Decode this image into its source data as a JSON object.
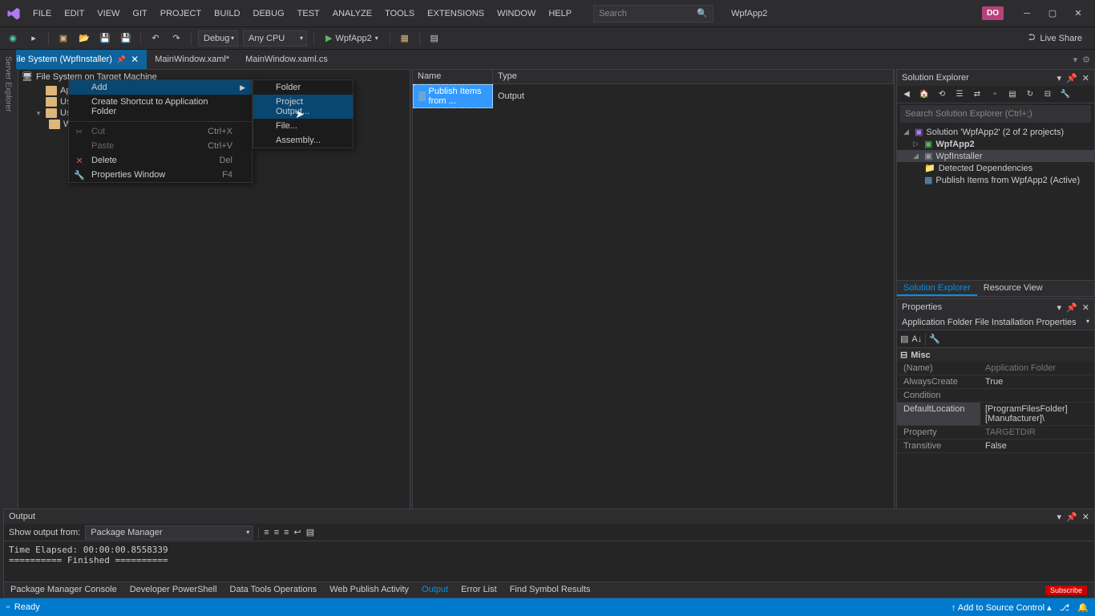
{
  "titlebar": {
    "menu": [
      "FILE",
      "EDIT",
      "VIEW",
      "GIT",
      "PROJECT",
      "BUILD",
      "DEBUG",
      "TEST",
      "ANALYZE",
      "TOOLS",
      "EXTENSIONS",
      "WINDOW",
      "HELP"
    ],
    "search_placeholder": "Search",
    "app_title": "WpfApp2",
    "user_initials": "DO"
  },
  "toolbar": {
    "config": "Debug",
    "platform": "Any CPU",
    "start_target": "WpfApp2",
    "live_share": "Live Share"
  },
  "tabs": [
    {
      "label": "File System (WpfInstaller)",
      "active": true,
      "pinned": true
    },
    {
      "label": "MainWindow.xaml*",
      "active": false
    },
    {
      "label": "MainWindow.xaml.cs",
      "active": false
    }
  ],
  "side_label": "Server Explorer",
  "tree": {
    "header": "File System on Target Machine",
    "items": [
      {
        "label": "Applica",
        "trunc": true
      },
      {
        "label": "User's D",
        "trunc": true
      },
      {
        "label": "User's P",
        "trunc": true,
        "expanded": true,
        "children": [
          {
            "label": "Wpf",
            "trunc": true
          }
        ]
      }
    ]
  },
  "list": {
    "cols": [
      "Name",
      "Type"
    ],
    "rows": [
      {
        "name": "Publish Items from ...",
        "type": "Output",
        "selected": true
      }
    ]
  },
  "context1": {
    "items": [
      {
        "label": "Add",
        "submenu": true,
        "highlight": true
      },
      {
        "label": "Create Shortcut to Application Folder"
      },
      {
        "sep": true
      },
      {
        "label": "Cut",
        "shortcut": "Ctrl+X",
        "disabled": true,
        "icon": "✂"
      },
      {
        "label": "Paste",
        "shortcut": "Ctrl+V",
        "disabled": true
      },
      {
        "label": "Delete",
        "shortcut": "Del",
        "icon": "✕"
      },
      {
        "label": "Properties Window",
        "shortcut": "F4",
        "icon": "🔧"
      }
    ]
  },
  "context2": {
    "items": [
      {
        "label": "Folder"
      },
      {
        "label": "Project Output...",
        "highlight": true
      },
      {
        "label": "File..."
      },
      {
        "label": "Assembly..."
      }
    ]
  },
  "solution_explorer": {
    "title": "Solution Explorer",
    "search_placeholder": "Search Solution Explorer (Ctrl+;)",
    "root": "Solution 'WpfApp2' (2 of 2 projects)",
    "projects": [
      {
        "name": "WpfApp2",
        "bold": true
      },
      {
        "name": "WpfInstaller",
        "selected": true,
        "expanded": true,
        "children": [
          {
            "name": "Detected Dependencies"
          },
          {
            "name": "Publish Items from WpfApp2 (Active)"
          }
        ]
      }
    ],
    "tabs": [
      "Solution Explorer",
      "Resource View"
    ]
  },
  "properties": {
    "title": "Properties",
    "object": "Application Folder  File Installation Properties",
    "category": "Misc",
    "rows": [
      {
        "name": "(Name)",
        "val": "Application Folder",
        "dim": true
      },
      {
        "name": "AlwaysCreate",
        "val": "True"
      },
      {
        "name": "Condition",
        "val": ""
      },
      {
        "name": "DefaultLocation",
        "val": "[ProgramFilesFolder][Manufacturer]\\",
        "selected": true
      },
      {
        "name": "Property",
        "val": "TARGETDIR",
        "dim": true
      },
      {
        "name": "Transitive",
        "val": "False"
      }
    ],
    "desc_title": "Misc"
  },
  "output": {
    "title": "Output",
    "show_from_label": "Show output from:",
    "source": "Package Manager",
    "lines": "Time Elapsed: 00:00:00.8558339\n========== Finished ==========",
    "tabs": [
      "Package Manager Console",
      "Developer PowerShell",
      "Data Tools Operations",
      "Web Publish Activity",
      "Output",
      "Error List",
      "Find Symbol Results"
    ]
  },
  "status": {
    "text": "Ready",
    "source_control": "Add to Source Control"
  },
  "subscribe": "Subscribe"
}
